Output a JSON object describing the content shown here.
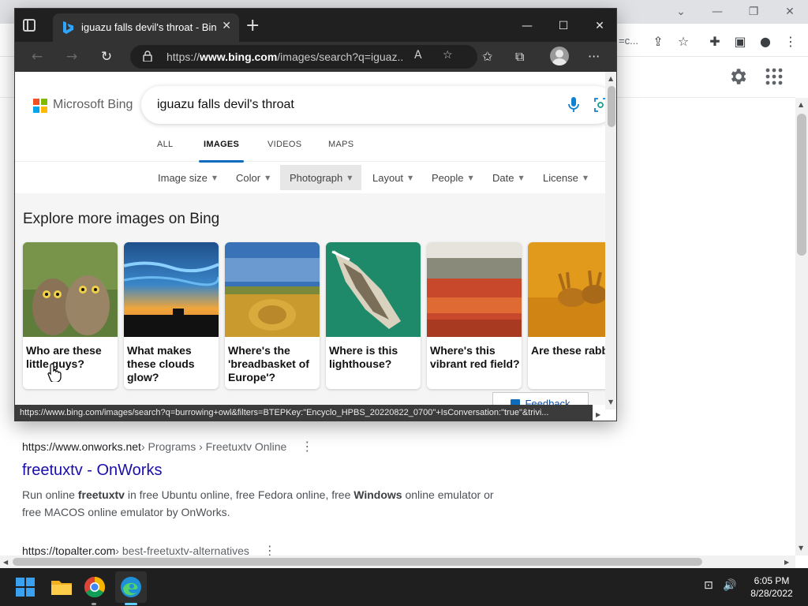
{
  "background_browser": {
    "url_tail": "=c...",
    "window_controls": {
      "chevron": "⌄",
      "minimize": "—",
      "restore": "❐",
      "close": "✕"
    },
    "toolbar_glyphs": {
      "share": "⇪",
      "bookmark": "☆",
      "extensions": "✚",
      "sidebar": "▣",
      "profile": "●",
      "menu": "⋮"
    },
    "results": [
      {
        "url_domain": "https://www.onworks.net",
        "url_path": " › Programs › Freetuxtv Online",
        "title": "freetuxtv - OnWorks",
        "snippet": {
          "t1": "Run online ",
          "b1": "freetuxtv",
          "t2": " in free Ubuntu online, free Fedora online, free ",
          "b2": "Windows",
          "t3": " online emulator or free MACOS online emulator by OnWorks."
        }
      },
      {
        "url_domain": "https://topalter.com",
        "url_path": " › best-freetuxtv-alternatives"
      }
    ],
    "more_glyph": "⋮"
  },
  "edge": {
    "tab_title": "iguazu falls devil's throat - Bing Images",
    "tab_close": "✕",
    "new_tab": "+",
    "window_controls": {
      "minimize": "—",
      "maximize": "☐",
      "close": "✕"
    },
    "nav": {
      "back": "←",
      "forward": "→",
      "refresh": "↻"
    },
    "address": {
      "prefix": "https://",
      "host": "www.bing.com",
      "path": "/images/search?q=iguaz..."
    },
    "toolbar_glyphs": {
      "read_aloud": "A",
      "add_favorite": "☆",
      "favorites": "✩",
      "collections": "⧉",
      "more": "···"
    },
    "status_url": "https://www.bing.com/images/search?q=burrowing+owl&filters=BTEPKey:\"Encyclo_HPBS_20220822_0700\"+IsConversation:\"true\"&trivi...",
    "colors": {
      "titlebar": "#202020",
      "toolbar": "#333333",
      "accent": "#0f6cbd"
    }
  },
  "bing": {
    "brand": "Microsoft Bing",
    "query": "iguazu falls devil's throat",
    "tabs": [
      "ALL",
      "IMAGES",
      "VIDEOS",
      "MAPS"
    ],
    "active_tab": "IMAGES",
    "filters": [
      "Image size",
      "Color",
      "Photograph",
      "Layout",
      "People",
      "Date",
      "License"
    ],
    "active_filter": "Photograph",
    "caret": "▼",
    "explore_title": "Explore more images on Bing",
    "cards": [
      {
        "caption": "Who are these little guys?"
      },
      {
        "caption": "What makes these clouds glow?"
      },
      {
        "caption": "Where's the 'breadbasket of Europe'?"
      },
      {
        "caption": "Where is this lighthouse?"
      },
      {
        "caption": "Where's this vibrant red field?"
      },
      {
        "caption": "Are these rabbits or hares?"
      }
    ],
    "feedback": "Feedback"
  },
  "taskbar": {
    "time": "6:05 PM",
    "date": "8/28/2022",
    "tray_glyphs": {
      "network": "⊡",
      "volume": "🔊"
    }
  }
}
